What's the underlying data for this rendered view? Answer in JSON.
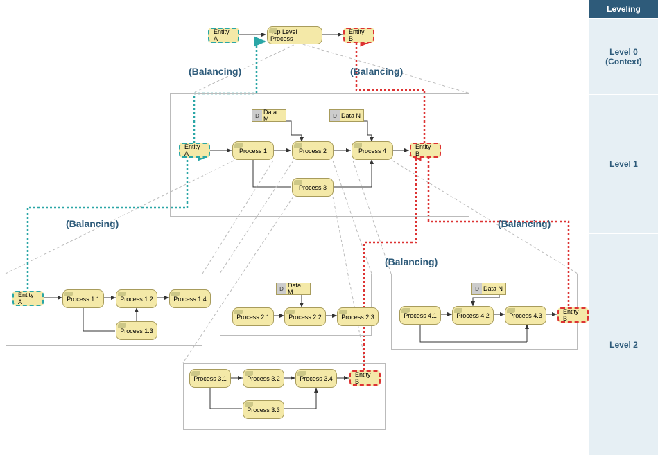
{
  "sidebar": {
    "header": "Leveling",
    "level0": "Level 0\n(Context)",
    "level1": "Level 1",
    "level2": "Level 2"
  },
  "level0": {
    "entityA": "Entity A",
    "process": "Top Level Process",
    "entityB": "Entity B"
  },
  "level1": {
    "entityA": "Entity A",
    "dataM": "Data M",
    "dataN": "Data N",
    "p1": "Process 1",
    "p2": "Process 2",
    "p3": "Process 3",
    "p4": "Process 4",
    "entityB": "Entity B"
  },
  "level2": {
    "g1": {
      "entityA": "Entity A",
      "p11": "Process 1.1",
      "p12": "Process 1.2",
      "p13": "Process 1.3",
      "p14": "Process 1.4"
    },
    "g2": {
      "dataM": "Data M",
      "p21": "Process 2.1",
      "p22": "Process 2.2",
      "p23": "Process 2.3"
    },
    "g3": {
      "p31": "Process 3.1",
      "p32": "Process 3.2",
      "p33": "Process 3.3",
      "p34": "Process 3.4",
      "entityB": "Entity B"
    },
    "g4": {
      "dataN": "Data N",
      "p41": "Process 4.1",
      "p42": "Process 4.2",
      "p43": "Process 4.3",
      "entityB": "Entity B"
    }
  },
  "labels": {
    "balancing": "(Balancing)"
  },
  "colors": {
    "teal": "#2aa6a6",
    "red": "#d33",
    "frame": "#2e5b7a",
    "fill": "#f4e9a8"
  }
}
